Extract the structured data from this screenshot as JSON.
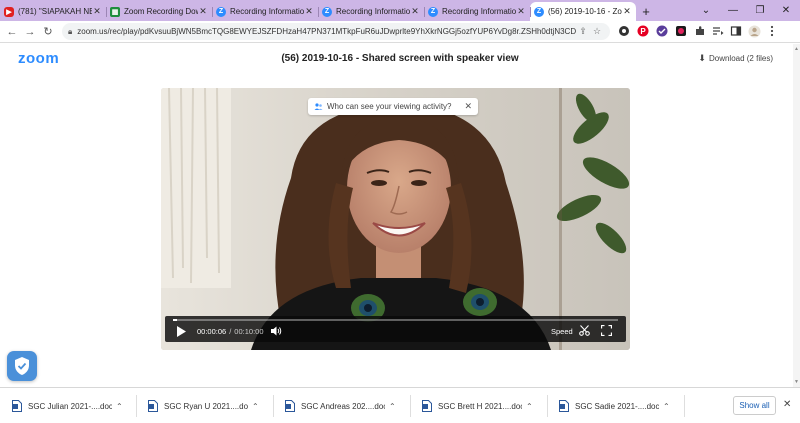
{
  "browser": {
    "tabs": [
      {
        "label": "(781) \"SIAPAKAH NEN",
        "favicon": "youtube-icon"
      },
      {
        "label": "Zoom Recording Dow",
        "favicon": "sheets-icon"
      },
      {
        "label": "Recording Informatio",
        "favicon": "zoom-icon"
      },
      {
        "label": "Recording Informatio",
        "favicon": "zoom-icon"
      },
      {
        "label": "Recording Informatio",
        "favicon": "zoom-icon"
      },
      {
        "label": "(56) 2019-10-16 - Zo",
        "favicon": "zoom-icon",
        "active": true
      }
    ],
    "url": "zoom.us/rec/play/pdKvsuuBjWN5BmcTQG8EWYEJSZFDHzaH47PN371MTkpFuR6uJDwprlte9YhXkrNGGj5ozfYUP6YvDg8r.ZSHh0dtjN3CDk..."
  },
  "header": {
    "logo": "zoom",
    "title": "(56) 2019-10-16 - Shared screen with speaker view",
    "download_label": "Download (2 files)"
  },
  "player": {
    "privacy_prompt": "Who can see your viewing activity?",
    "current_time": "00:00:06",
    "duration": "00:10:00",
    "progress": 0.01,
    "speed_label": "Speed"
  },
  "downloads": {
    "items": [
      {
        "name": "SGC Julian 2021-....docx"
      },
      {
        "name": "SGC Ryan U 2021....docx"
      },
      {
        "name": "SGC Andreas 202....docx"
      },
      {
        "name": "SGC Brett H 2021....docx"
      },
      {
        "name": "SGC Sadie 2021-....docx"
      }
    ],
    "show_all_label": "Show all"
  },
  "colors": {
    "tabstrip": "#cdb6e6",
    "zoom_blue": "#2d8cff",
    "shield": "#4a90d9"
  }
}
